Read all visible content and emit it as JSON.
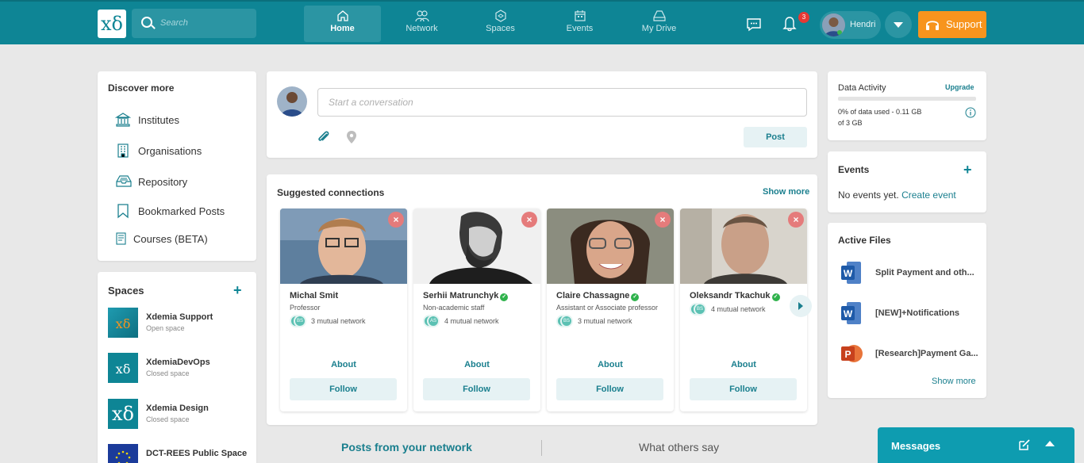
{
  "header": {
    "logo_text": "xδ",
    "search_placeholder": "Search",
    "nav": [
      {
        "label": "Home",
        "icon": "home-icon",
        "active": true
      },
      {
        "label": "Network",
        "icon": "network-icon"
      },
      {
        "label": "Spaces",
        "icon": "spaces-icon"
      },
      {
        "label": "Events",
        "icon": "events-icon"
      },
      {
        "label": "My Drive",
        "icon": "drive-icon"
      }
    ],
    "notifications_count": "3",
    "user_name": "Hendri",
    "support_label": "Support"
  },
  "discover": {
    "title": "Discover more",
    "items": [
      {
        "label": "Institutes",
        "icon": "institute-icon"
      },
      {
        "label": "Organisations",
        "icon": "organisation-icon"
      },
      {
        "label": "Repository",
        "icon": "repository-icon"
      },
      {
        "label": "Bookmarked Posts",
        "icon": "bookmark-icon"
      },
      {
        "label": "Courses (BETA)",
        "icon": "courses-icon"
      }
    ]
  },
  "spaces": {
    "title": "Spaces",
    "add_label": "+",
    "items": [
      {
        "name": "Xdemia Support",
        "type": "Open space",
        "logo": "xδ"
      },
      {
        "name": "XdemiaDevOps",
        "type": "Closed space",
        "logo": "xδ"
      },
      {
        "name": "Xdemia Design",
        "type": "Closed space",
        "logo": "xδ"
      },
      {
        "name": "DCT-REES Public Space",
        "type": "",
        "logo": ""
      }
    ]
  },
  "composer": {
    "placeholder": "Start a conversation",
    "post_label": "Post"
  },
  "suggested": {
    "title": "Suggested connections",
    "show_more": "Show more",
    "close_glyph": "×",
    "people": [
      {
        "name": "Michal Smit",
        "verified": false,
        "role": "Professor",
        "mutual_initials": "BS",
        "mutual": "3 mutual network",
        "about": "About",
        "follow": "Follow"
      },
      {
        "name": "Serhii Matrunchyk",
        "verified": true,
        "role": "Non-academic staff",
        "mutual_initials": "AS",
        "mutual": "4 mutual network",
        "about": "About",
        "follow": "Follow"
      },
      {
        "name": "Claire Chassagne",
        "verified": true,
        "role": "Assistant or Associate professor",
        "mutual_initials": "BS",
        "mutual": "3 mutual network",
        "about": "About",
        "follow": "Follow"
      },
      {
        "name": "Oleksandr Tkachuk",
        "verified": true,
        "role": "",
        "mutual_initials": "BS",
        "mutual": "4 mutual network",
        "about": "About",
        "follow": "Follow"
      }
    ]
  },
  "feed_tabs": {
    "network": "Posts from your network",
    "others": "What others say"
  },
  "data_activity": {
    "title": "Data Activity",
    "upgrade": "Upgrade",
    "used_line1": "0% of data used - 0.11 GB",
    "used_line2": "of 3 GB",
    "percent": 0
  },
  "events": {
    "title": "Events",
    "add_label": "+",
    "empty": "No events yet.",
    "create": "Create event"
  },
  "active_files": {
    "title": "Active Files",
    "files": [
      {
        "name": "Split Payment and oth...",
        "type": "word"
      },
      {
        "name": "[NEW]+Notifications",
        "type": "word"
      },
      {
        "name": "[Research]Payment Ga...",
        "type": "powerpoint"
      }
    ],
    "show_more": "Show more"
  },
  "messages": {
    "title": "Messages"
  },
  "colors": {
    "brand": "#0e8595",
    "accent": "#f7941d",
    "link": "#1a7f8e",
    "messages": "#0e9cb0",
    "badge": "#e53935"
  }
}
